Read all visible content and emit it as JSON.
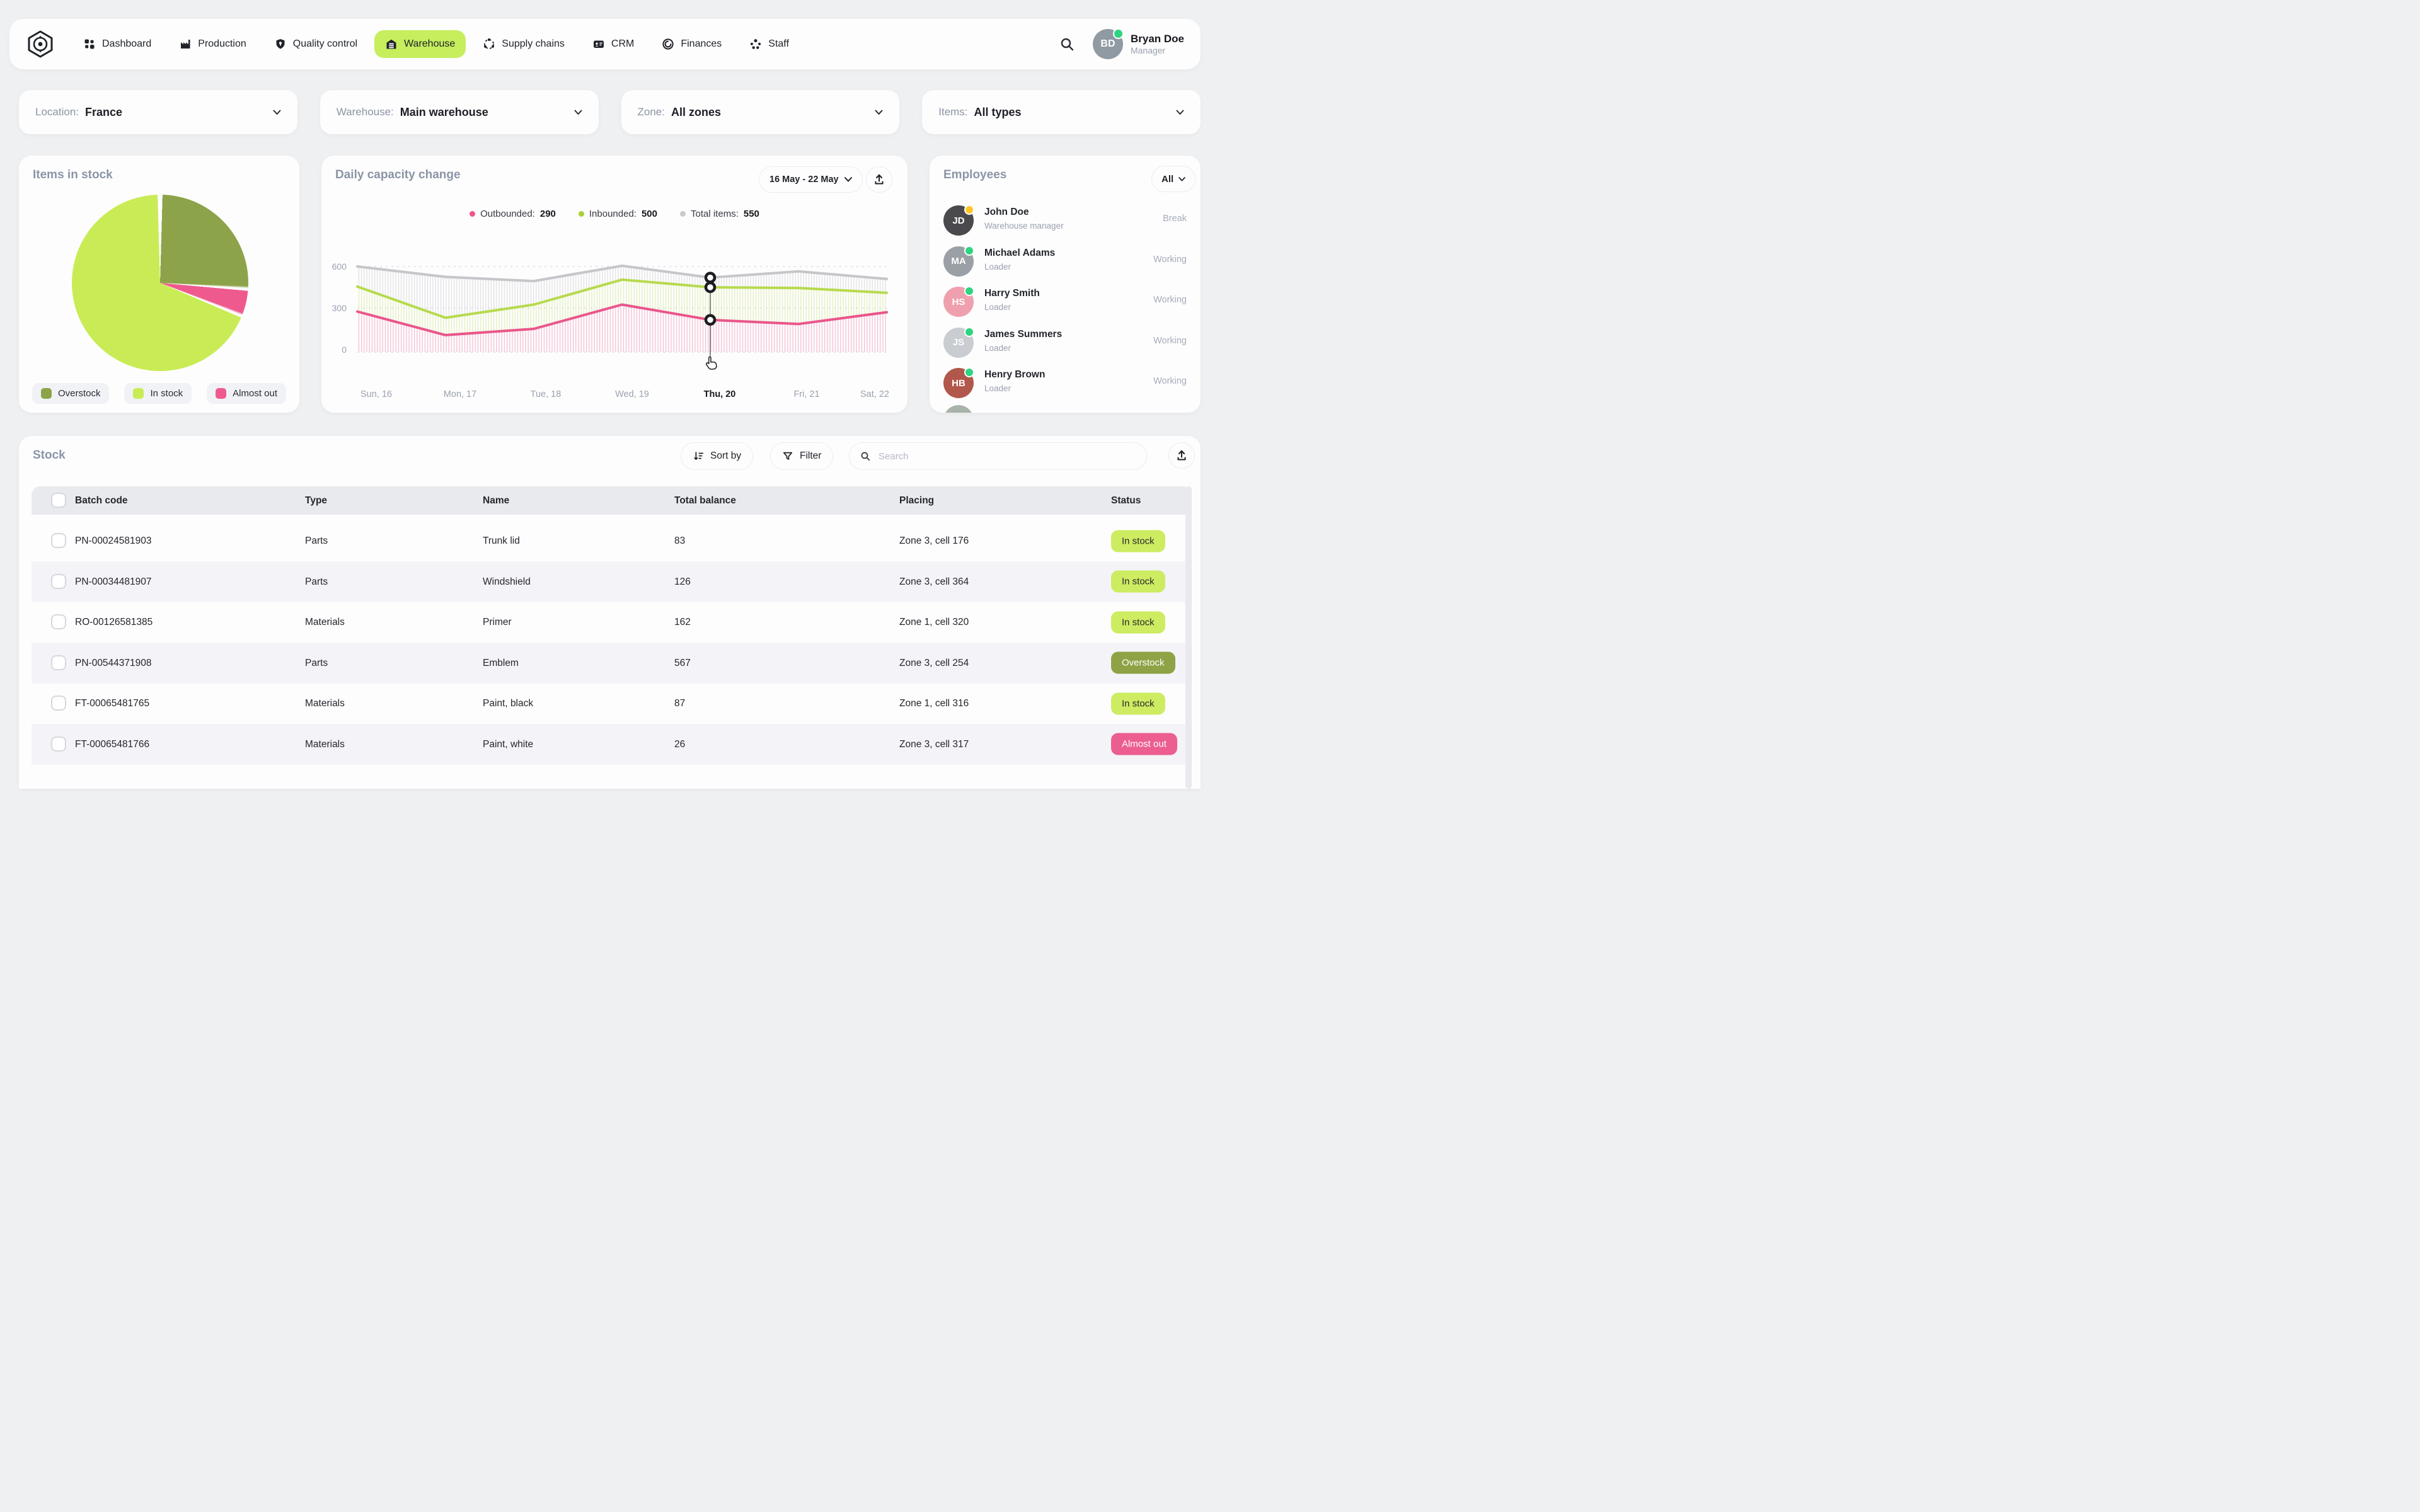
{
  "nav": {
    "items": [
      {
        "label": "Dashboard",
        "icon": "dashboard-icon",
        "active": false
      },
      {
        "label": "Production",
        "icon": "production-icon",
        "active": false
      },
      {
        "label": "Quality control",
        "icon": "quality-icon",
        "active": false
      },
      {
        "label": "Warehouse",
        "icon": "warehouse-icon",
        "active": true
      },
      {
        "label": "Supply chains",
        "icon": "supply-chains-icon",
        "active": false
      },
      {
        "label": "CRM",
        "icon": "crm-icon",
        "active": false
      },
      {
        "label": "Finances",
        "icon": "finances-icon",
        "active": false
      },
      {
        "label": "Staff",
        "icon": "staff-icon",
        "active": false
      }
    ],
    "active_bg": "#c6ee5d",
    "user": {
      "name": "Bryan Doe",
      "role": "Manager",
      "initials": "BD",
      "status_color": "#2ed47f"
    }
  },
  "filters": [
    {
      "label": "Location:",
      "value": "France"
    },
    {
      "label": "Warehouse:",
      "value": "Main warehouse"
    },
    {
      "label": "Zone:",
      "value": "All zones"
    },
    {
      "label": "Items:",
      "value": "All types"
    }
  ],
  "items_in_stock": {
    "title": "Items in stock",
    "legend": [
      {
        "label": "Overstock",
        "color": "#8da349"
      },
      {
        "label": "In stock",
        "color": "#c9ec56"
      },
      {
        "label": "Almost out",
        "color": "#ee5a8e"
      }
    ]
  },
  "capacity": {
    "title": "Daily capacity change",
    "date_range": "16 May - 22 May",
    "legend": [
      {
        "label": "Outbounded:",
        "value": "290",
        "color": "#f4538b"
      },
      {
        "label": "Inbounded:",
        "value": "500",
        "color": "#a8d139"
      },
      {
        "label": "Total items:",
        "value": "550",
        "color": "#c9c9cf"
      }
    ]
  },
  "employees": {
    "title": "Employees",
    "filter_label": "All",
    "list": [
      {
        "name": "John Doe",
        "role": "Warehouse manager",
        "status": "Break",
        "dot": "#ffc726",
        "avatar_bg": "#4a4a4e",
        "initials": "JD"
      },
      {
        "name": "Michael Adams",
        "role": "Loader",
        "status": "Working",
        "dot": "#2ed47f",
        "avatar_bg": "#9aa0a6",
        "initials": "MA"
      },
      {
        "name": "Harry Smith",
        "role": "Loader",
        "status": "Working",
        "dot": "#2ed47f",
        "avatar_bg": "#efa0ae",
        "initials": "HS"
      },
      {
        "name": "James Summers",
        "role": "Loader",
        "status": "Working",
        "dot": "#2ed47f",
        "avatar_bg": "#c9ccd1",
        "initials": "JS"
      },
      {
        "name": "Henry Brown",
        "role": "Loader",
        "status": "Working",
        "dot": "#2ed47f",
        "avatar_bg": "#b2574b",
        "initials": "HB"
      }
    ]
  },
  "stock": {
    "title": "Stock",
    "sort_label": "Sort by",
    "filter_label": "Filter",
    "search_placeholder": "Search",
    "columns": [
      "Batch code",
      "Type",
      "Name",
      "Total balance",
      "Placing",
      "Status"
    ],
    "rows": [
      {
        "batch": "PN-00024581903",
        "type": "Parts",
        "name": "Trunk lid",
        "balance": "83",
        "placing": "Zone 3, cell 176",
        "status": "In stock"
      },
      {
        "batch": "PN-00034481907",
        "type": "Parts",
        "name": "Windshield",
        "balance": "126",
        "placing": "Zone 3, cell 364",
        "status": "In stock"
      },
      {
        "batch": "RO-00126581385",
        "type": "Materials",
        "name": "Primer",
        "balance": "162",
        "placing": "Zone 1, cell 320",
        "status": "In stock"
      },
      {
        "batch": "PN-00544371908",
        "type": "Parts",
        "name": "Emblem",
        "balance": "567",
        "placing": "Zone 3, cell 254",
        "status": "Overstock"
      },
      {
        "batch": "FT-00065481765",
        "type": "Materials",
        "name": "Paint, black",
        "balance": "87",
        "placing": "Zone 1, cell 316",
        "status": "In stock"
      },
      {
        "batch": "FT-00065481766",
        "type": "Materials",
        "name": "Paint, white",
        "balance": "26",
        "placing": "Zone 3, cell 317",
        "status": "Almost out"
      }
    ],
    "status_colors": {
      "In stock": {
        "bg": "#cdec61",
        "text": "#25282d"
      },
      "Overstock": {
        "bg": "#8ea345",
        "text": "#ffffff"
      },
      "Almost out": {
        "bg": "#ec5e90",
        "text": "#ffffff"
      }
    }
  },
  "chart_data": [
    {
      "type": "pie",
      "title": "Items in stock",
      "labels": [
        "Overstock",
        "In stock",
        "Almost out"
      ],
      "values": [
        26,
        69,
        5
      ],
      "unit": "percent",
      "colors": [
        "#8da349",
        "#c9ec56",
        "#ee5a8e"
      ],
      "clockwise_order": [
        0,
        2,
        1
      ],
      "start_angle": 0,
      "slice_gap_deg": 1.6
    },
    {
      "type": "line",
      "title": "Daily capacity change",
      "categories": [
        "Sun, 16",
        "Mon, 17",
        "Tue, 18",
        "Wed, 19",
        "Thu, 20",
        "Fri, 21",
        "Sat, 22"
      ],
      "series": [
        {
          "name": "Total items",
          "color": "#c6c6ca",
          "values": [
            600,
            525,
            495,
            605,
            520,
            565,
            510
          ]
        },
        {
          "name": "Inbounded",
          "color": "#b7da4e",
          "values": [
            455,
            230,
            325,
            505,
            450,
            445,
            410
          ]
        },
        {
          "name": "Outbounded",
          "color": "#e9568b",
          "values": [
            275,
            105,
            150,
            325,
            215,
            185,
            270
          ]
        }
      ],
      "ylim": [
        0,
        600
      ],
      "yticks": [
        0,
        300,
        600
      ],
      "highlight": "Thu, 20",
      "legend_position": "top",
      "grid": "dashed-horizontal",
      "fill": "vertical-hatch"
    }
  ]
}
